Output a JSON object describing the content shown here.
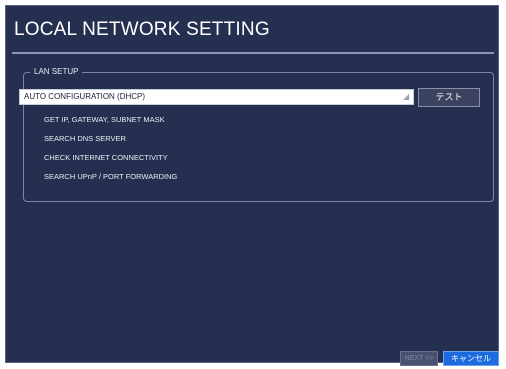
{
  "window": {
    "title": "LOCAL NETWORK SETTING"
  },
  "lan_setup": {
    "legend": "LAN SETUP",
    "mode_select": {
      "selected": "AUTO CONFIGURATION (DHCP)"
    },
    "test_button": "テスト",
    "steps": [
      "GET IP, GATEWAY, SUBNET MASK",
      "SEARCH DNS SERVER",
      "CHECK INTERNET CONNECTIVITY",
      "SEARCH UPnP / PORT FORWARDING"
    ]
  },
  "footer": {
    "next_button": "NEXT >>",
    "cancel_button": "キャンセル"
  },
  "colors": {
    "background": "#253051",
    "accent_button": "#1c6ce0"
  }
}
